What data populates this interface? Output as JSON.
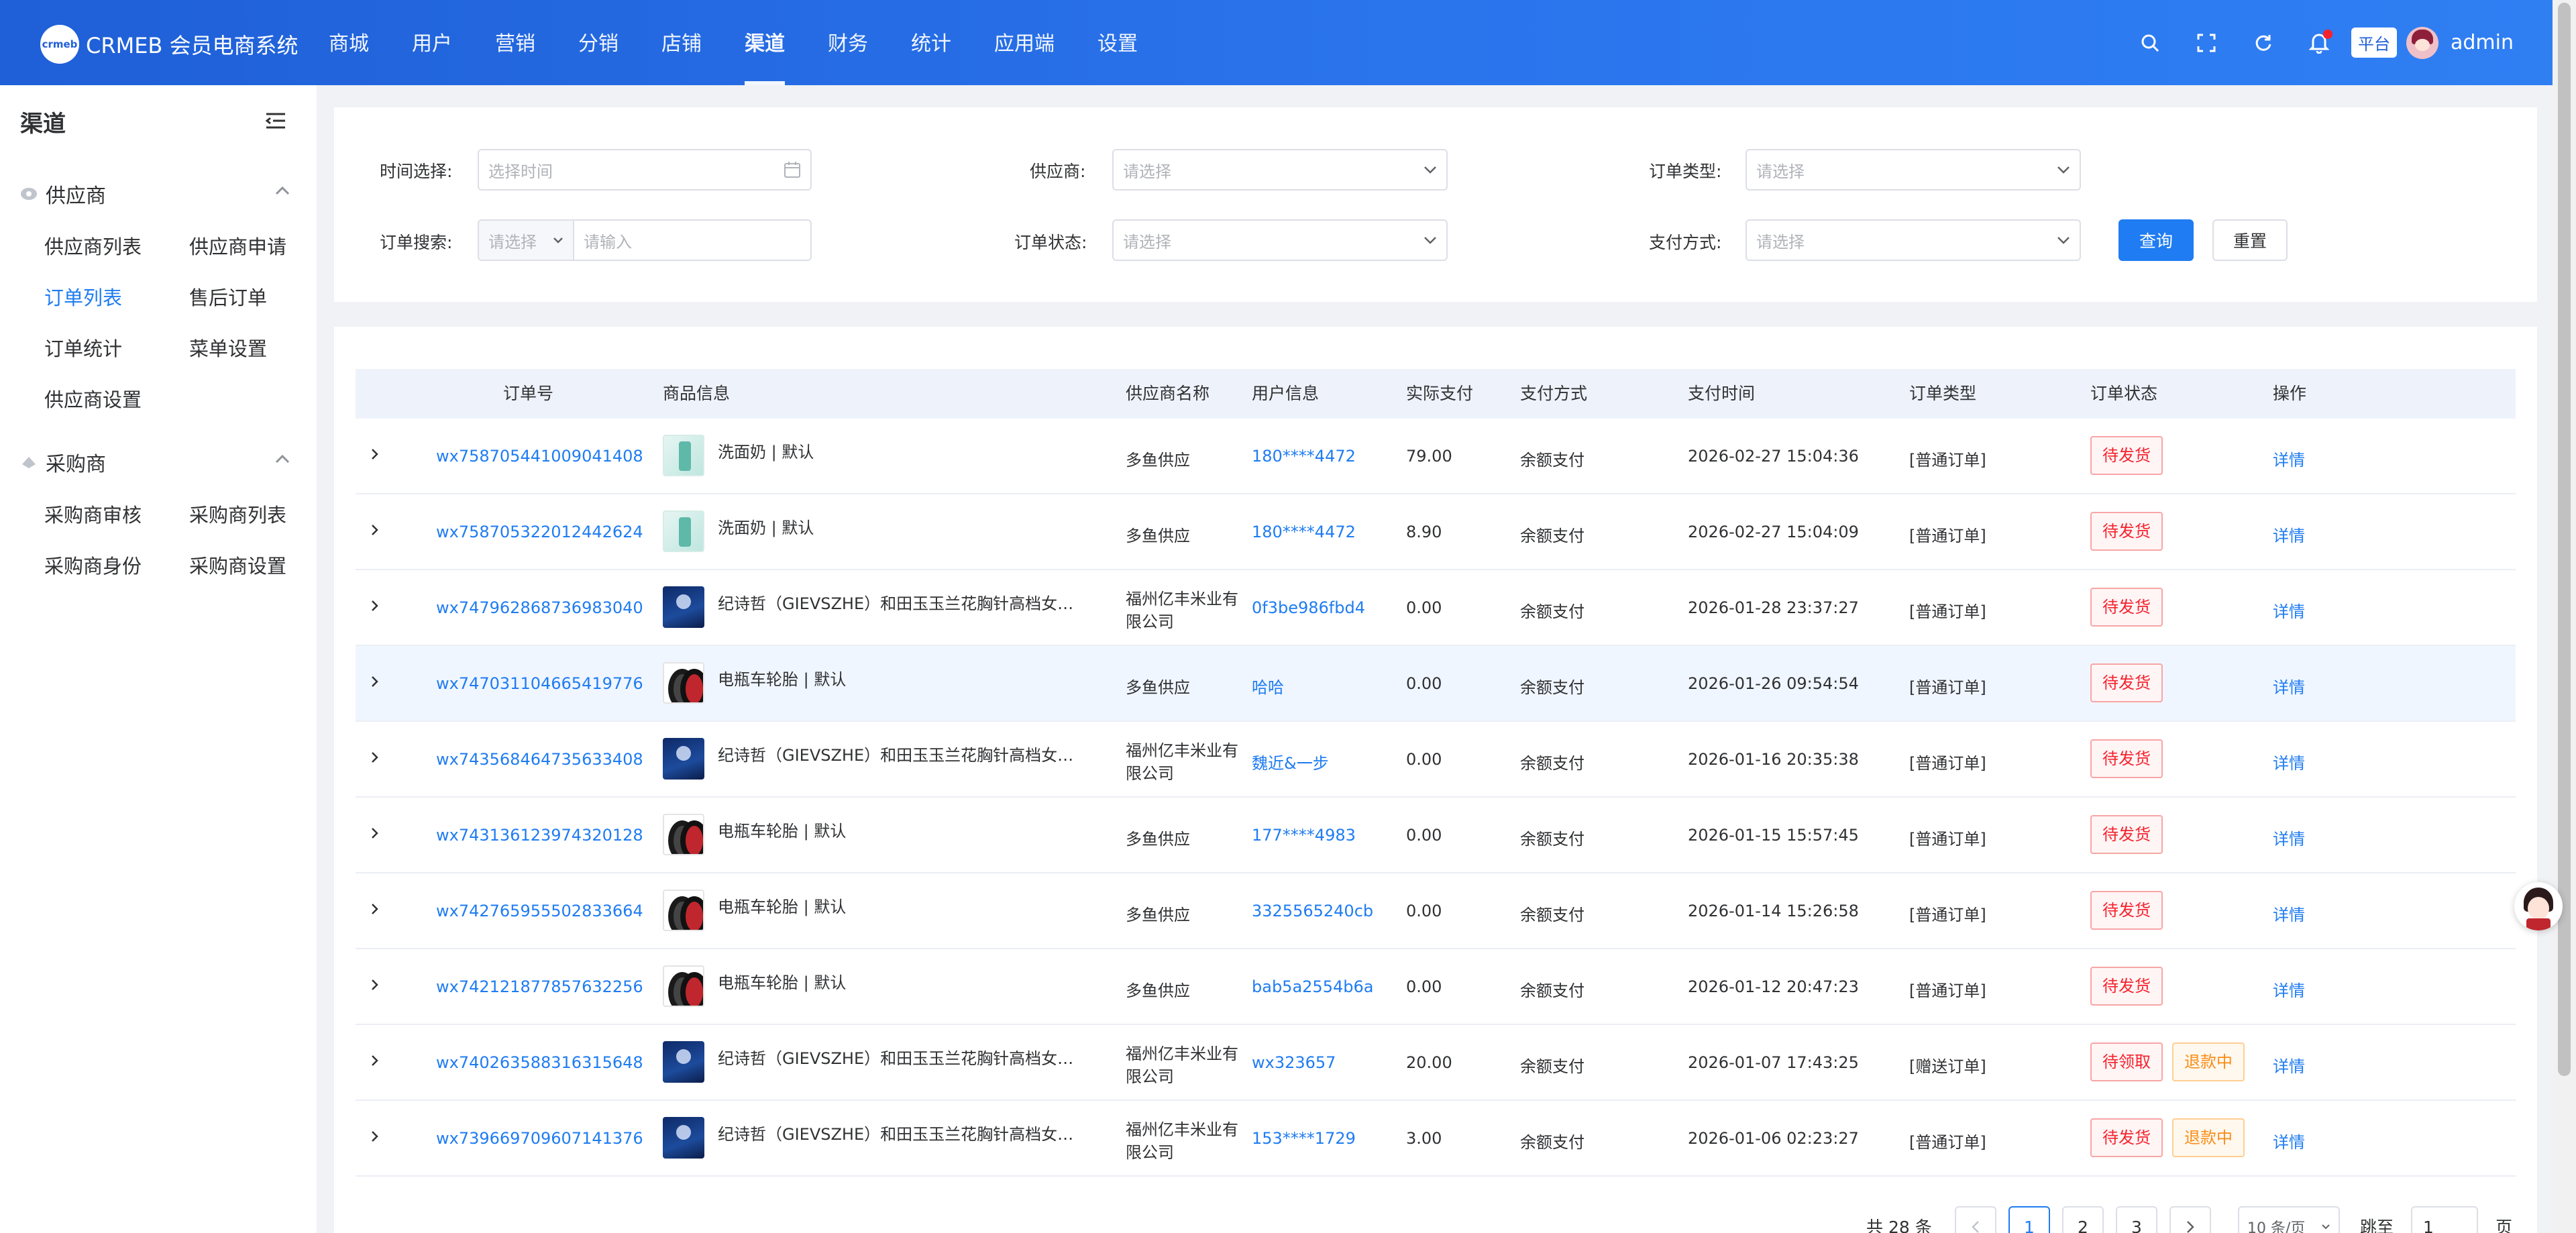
{
  "brand": {
    "logo_mark": "crmeb",
    "name": "CRMEB 会员电商系统"
  },
  "nav": [
    "商城",
    "用户",
    "营销",
    "分销",
    "店铺",
    "渠道",
    "财务",
    "统计",
    "应用端",
    "设置"
  ],
  "header": {
    "platform": "平台",
    "username": "admin"
  },
  "sidebar": {
    "title": "渠道",
    "groups": [
      {
        "label": "供应商",
        "items": [
          "供应商列表",
          "供应商申请",
          "订单列表",
          "售后订单",
          "订单统计",
          "菜单设置",
          "供应商设置"
        ]
      },
      {
        "label": "采购商",
        "items": [
          "采购商审核",
          "采购商列表",
          "采购商身份",
          "采购商设置"
        ]
      }
    ]
  },
  "filters": {
    "time_label": "时间选择:",
    "time_placeholder": "选择时间",
    "supplier_label": "供应商:",
    "supplier_placeholder": "请选择",
    "order_type_label": "订单类型:",
    "order_type_placeholder": "请选择",
    "search_label": "订单搜索:",
    "search_type_placeholder": "请选择",
    "search_placeholder": "请输入",
    "status_label": "订单状态:",
    "status_placeholder": "请选择",
    "pay_label": "支付方式:",
    "pay_placeholder": "请选择",
    "query_button": "查询",
    "reset_button": "重置"
  },
  "table": {
    "columns": [
      "订单号",
      "商品信息",
      "供应商名称",
      "用户信息",
      "实际支付",
      "支付方式",
      "支付时间",
      "订单类型",
      "订单状态",
      "操作"
    ],
    "rows": [
      {
        "order_no": "wx758705441009041408",
        "product": "洗面奶 | 默认",
        "supplier": "多鱼供应",
        "user": "180****4472",
        "paid": "79.00",
        "pay_method": "余额支付",
        "pay_time": "2026-02-27 15:04:36",
        "type": "[普通订单]",
        "status": "待发货",
        "extra_status": "",
        "action": "详情"
      },
      {
        "order_no": "wx758705322012442624",
        "product": "洗面奶 | 默认",
        "supplier": "多鱼供应",
        "user": "180****4472",
        "paid": "8.90",
        "pay_method": "余额支付",
        "pay_time": "2026-02-27 15:04:09",
        "type": "[普通订单]",
        "status": "待发货",
        "extra_status": "",
        "action": "详情"
      },
      {
        "order_no": "wx747962868736983040",
        "product": "纪诗哲（GIEVSZHE）和田玉玉兰花胸针高档女…",
        "supplier": "福州亿丰米业有限公司",
        "user": "0f3be986fbd4",
        "paid": "0.00",
        "pay_method": "余额支付",
        "pay_time": "2026-01-28 23:37:27",
        "type": "[普通订单]",
        "status": "待发货",
        "extra_status": "",
        "action": "详情"
      },
      {
        "order_no": "wx747031104665419776",
        "product": "电瓶车轮胎 | 默认",
        "supplier": "多鱼供应",
        "user": "哈哈",
        "paid": "0.00",
        "pay_method": "余额支付",
        "pay_time": "2026-01-26 09:54:54",
        "type": "[普通订单]",
        "status": "待发货",
        "extra_status": "",
        "action": "详情"
      },
      {
        "order_no": "wx743568464735633408",
        "product": "纪诗哲（GIEVSZHE）和田玉玉兰花胸针高档女…",
        "supplier": "福州亿丰米业有限公司",
        "user": "魏近&一步",
        "paid": "0.00",
        "pay_method": "余额支付",
        "pay_time": "2026-01-16 20:35:38",
        "type": "[普通订单]",
        "status": "待发货",
        "extra_status": "",
        "action": "详情"
      },
      {
        "order_no": "wx743136123974320128",
        "product": "电瓶车轮胎 | 默认",
        "supplier": "多鱼供应",
        "user": "177****4983",
        "paid": "0.00",
        "pay_method": "余额支付",
        "pay_time": "2026-01-15 15:57:45",
        "type": "[普通订单]",
        "status": "待发货",
        "extra_status": "",
        "action": "详情"
      },
      {
        "order_no": "wx742765955502833664",
        "product": "电瓶车轮胎 | 默认",
        "supplier": "多鱼供应",
        "user": "3325565240cb",
        "paid": "0.00",
        "pay_method": "余额支付",
        "pay_time": "2026-01-14 15:26:58",
        "type": "[普通订单]",
        "status": "待发货",
        "extra_status": "",
        "action": "详情"
      },
      {
        "order_no": "wx742121877857632256",
        "product": "电瓶车轮胎 | 默认",
        "supplier": "多鱼供应",
        "user": "bab5a2554b6a",
        "paid": "0.00",
        "pay_method": "余额支付",
        "pay_time": "2026-01-12 20:47:23",
        "type": "[普通订单]",
        "status": "待发货",
        "extra_status": "",
        "action": "详情"
      },
      {
        "order_no": "wx740263588316315648",
        "product": "纪诗哲（GIEVSZHE）和田玉玉兰花胸针高档女…",
        "supplier": "福州亿丰米业有限公司",
        "user": "wx323657",
        "paid": "20.00",
        "pay_method": "余额支付",
        "pay_time": "2026-01-07 17:43:25",
        "type": "[赠送订单]",
        "status": "待领取",
        "extra_status": "退款中",
        "action": "详情"
      },
      {
        "order_no": "wx739669709607141376",
        "product": "纪诗哲（GIEVSZHE）和田玉玉兰花胸针高档女…",
        "supplier": "福州亿丰米业有限公司",
        "user": "153****1729",
        "paid": "3.00",
        "pay_method": "余额支付",
        "pay_time": "2026-01-06 02:23:27",
        "type": "[普通订单]",
        "status": "待发货",
        "extra_status": "退款中",
        "action": "详情"
      }
    ]
  },
  "pagination": {
    "total": "共 28 条",
    "pages": [
      "1",
      "2",
      "3"
    ],
    "current": "1",
    "page_size": "10 条/页",
    "jump_label": "跳至",
    "jump_value": "1",
    "page_unit": "页"
  },
  "colors": {
    "header": "#2a74ec",
    "accent": "#1f7cf2",
    "status_red": "#f5222d",
    "status_orange": "#fa8c16"
  }
}
